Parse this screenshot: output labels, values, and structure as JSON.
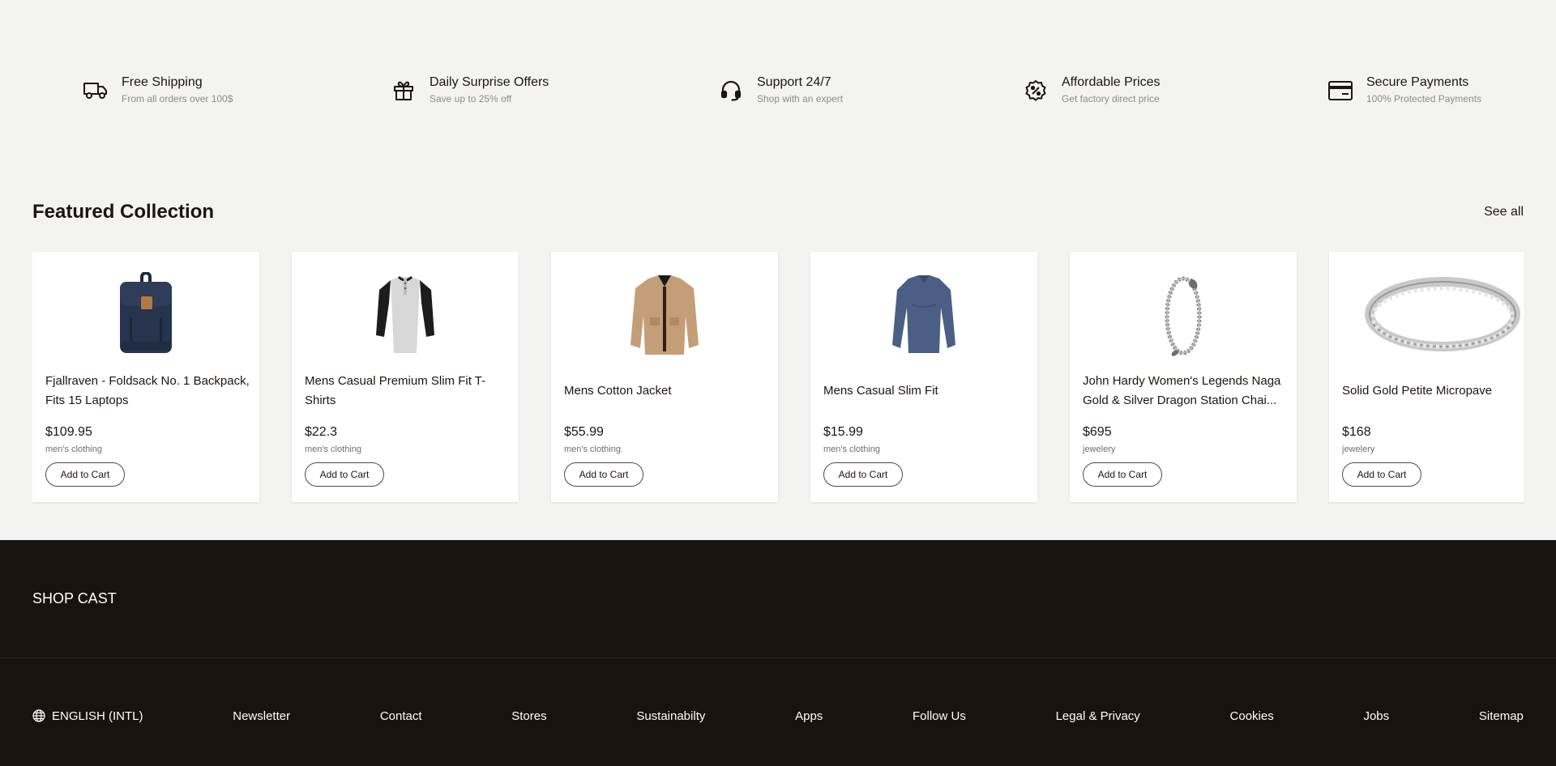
{
  "features": [
    {
      "icon": "truck-icon",
      "title": "Free Shipping",
      "subtitle": "From all orders over 100$"
    },
    {
      "icon": "gift-icon",
      "title": "Daily Surprise Offers",
      "subtitle": "Save up to 25% off"
    },
    {
      "icon": "headset-icon",
      "title": "Support 24/7",
      "subtitle": "Shop with an expert"
    },
    {
      "icon": "discount-badge-icon",
      "title": "Affordable Prices",
      "subtitle": "Get factory direct price"
    },
    {
      "icon": "credit-card-icon",
      "title": "Secure Payments",
      "subtitle": "100% Protected Payments"
    }
  ],
  "featured": {
    "title": "Featured Collection",
    "see_all": "See all",
    "products": [
      {
        "image": "backpack",
        "name": "Fjallraven - Foldsack No. 1 Backpack, Fits 15 Laptops",
        "price": "$109.95",
        "category": "men's clothing",
        "cta": "Add to Cart"
      },
      {
        "image": "raglan-tshirt",
        "name": "Mens Casual Premium Slim Fit T-Shirts",
        "price": "$22.3",
        "category": "men's clothing",
        "cta": "Add to Cart"
      },
      {
        "image": "cotton-jacket",
        "name": "Mens Cotton Jacket",
        "price": "$55.99",
        "category": "men's clothing",
        "cta": "Add to Cart"
      },
      {
        "image": "long-sleeve-shirt",
        "name": "Mens Casual Slim Fit",
        "price": "$15.99",
        "category": "men's clothing",
        "cta": "Add to Cart"
      },
      {
        "image": "dragon-bracelet",
        "name": "John Hardy Women's Legends Naga Gold & Silver Dragon Station Chai...",
        "price": "$695",
        "category": "jewelery",
        "cta": "Add to Cart"
      },
      {
        "image": "micropave-ring",
        "name": "Solid Gold Petite Micropave",
        "price": "$168",
        "category": "jewelery",
        "cta": "Add to Cart"
      }
    ]
  },
  "footer": {
    "brand": "SHOP CAST",
    "language": "ENGLISH (INTL)",
    "links": [
      "Newsletter",
      "Contact",
      "Stores",
      "Sustainabilty",
      "Apps",
      "Follow Us",
      "Legal & Privacy",
      "Cookies",
      "Jobs",
      "Sitemap"
    ]
  },
  "colors": {
    "page_bg": "#f3f4f2",
    "footer_bg": "#1a120e",
    "text": "#1b1512",
    "muted": "#8b8b8b"
  }
}
